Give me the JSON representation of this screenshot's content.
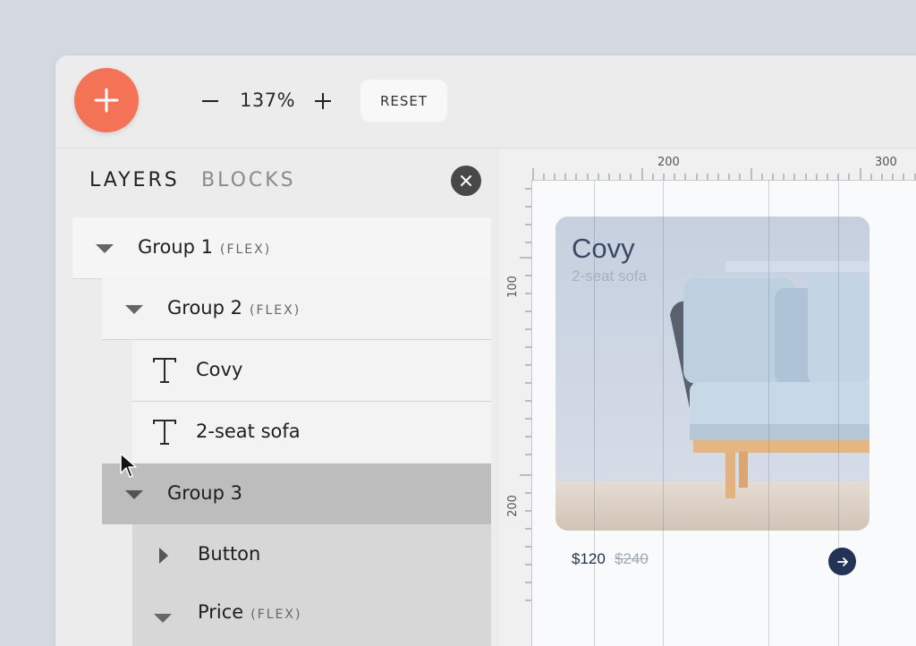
{
  "toolbar": {
    "add_icon": "plus-icon",
    "zoom_out_icon": "minus-icon",
    "zoom_level": "137%",
    "zoom_in_icon": "plus-icon",
    "reset_label": "RESET"
  },
  "panel": {
    "tabs": [
      "LAYERS",
      "BLOCKS"
    ],
    "close_icon": "close-icon",
    "layers": [
      {
        "label": "Group 1",
        "tag": "(FLEX)",
        "icon": "caret-down-icon"
      },
      {
        "label": "Group 2",
        "tag": "(FLEX)",
        "icon": "caret-down-icon"
      },
      {
        "label": "Covy",
        "icon": "text-icon"
      },
      {
        "label": "2-seat sofa",
        "icon": "text-icon"
      },
      {
        "label": "Group 3",
        "icon": "caret-down-icon",
        "selected": true
      },
      {
        "label": "Button",
        "icon": "caret-right-icon"
      },
      {
        "label": "Price",
        "tag": "(FLEX)",
        "icon": "caret-down-icon"
      }
    ]
  },
  "canvas": {
    "ruler_top": [
      "200",
      "300"
    ],
    "ruler_left": [
      "100",
      "200"
    ]
  },
  "card": {
    "title": "Covy",
    "subtitle": "2-seat sofa",
    "price": "$120",
    "old_price": "$240",
    "button_icon": "arrow-right-icon"
  },
  "colors": {
    "accent": "#f47356",
    "selected_row": "#bdbdbd",
    "navy": "#223355"
  }
}
